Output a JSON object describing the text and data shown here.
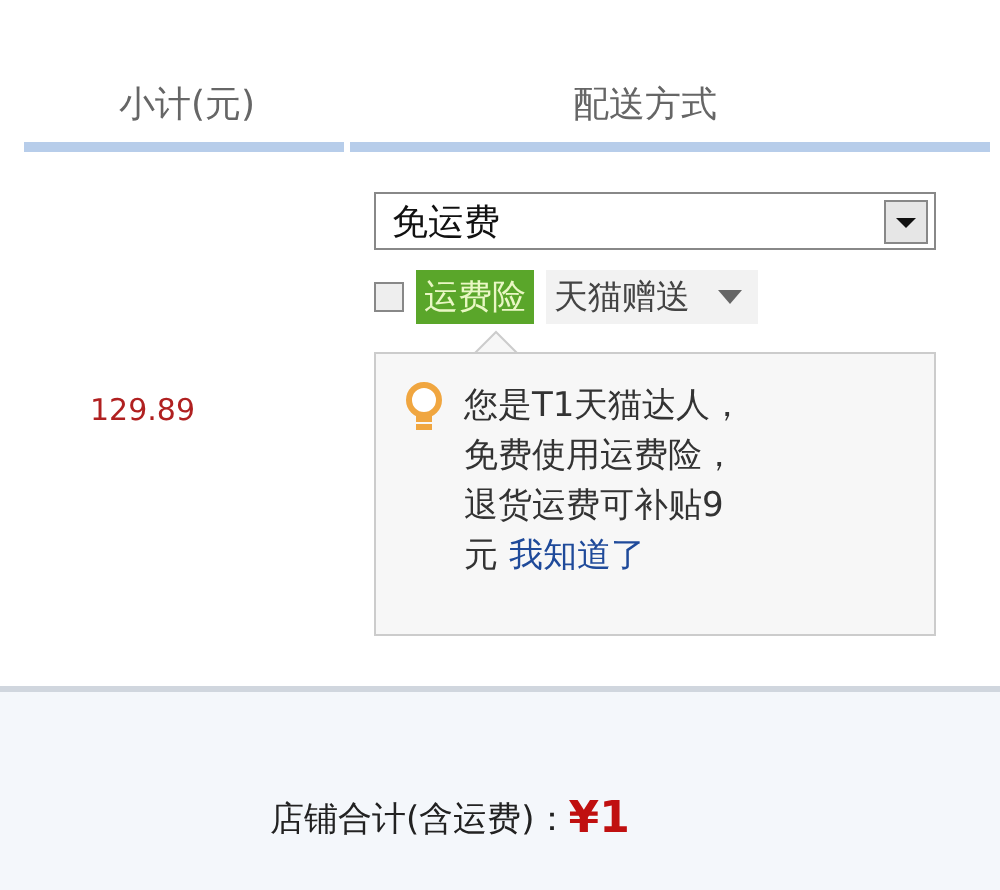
{
  "table": {
    "columns": [
      "小计(元)",
      "配送方式"
    ]
  },
  "row": {
    "subtotal": "129.89",
    "shipping_select": {
      "value": "免运费"
    },
    "insurance": {
      "checked": false,
      "badge": "运费险",
      "gift": "天猫赠送"
    },
    "tip": {
      "lines": [
        "您是T1天猫达人，",
        "免费使用运费险，",
        "退货运费可补贴9",
        "元"
      ],
      "link": "我知道了"
    }
  },
  "footer": {
    "label": "店铺合计(含运费)：",
    "total": "¥1"
  }
}
